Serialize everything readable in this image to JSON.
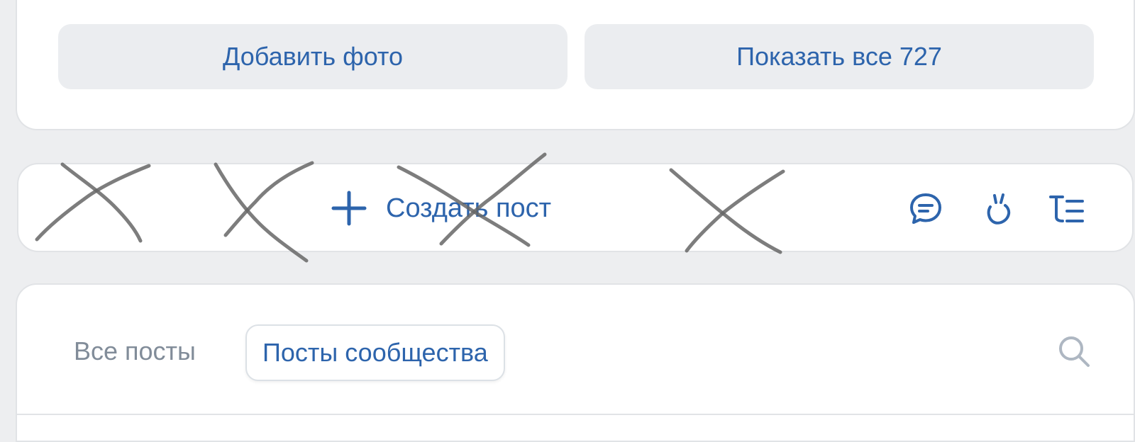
{
  "photos": {
    "add_photo_label": "Добавить фото",
    "show_all_label": "Показать все 727"
  },
  "post_bar": {
    "create_post_label": "Создать пост",
    "icons": [
      "plus-icon",
      "chat-bubble-icon",
      "clip-icon",
      "text-format-icon"
    ]
  },
  "feed": {
    "tabs": [
      {
        "label": "Все посты",
        "selected": false
      },
      {
        "label": "Посты сообщества",
        "selected": true
      }
    ],
    "search_icon": "search-icon"
  },
  "colors": {
    "accent": "#2d64ac",
    "background": "#edeef0",
    "button_bg": "#ebedf0",
    "muted_text": "#818c99"
  }
}
